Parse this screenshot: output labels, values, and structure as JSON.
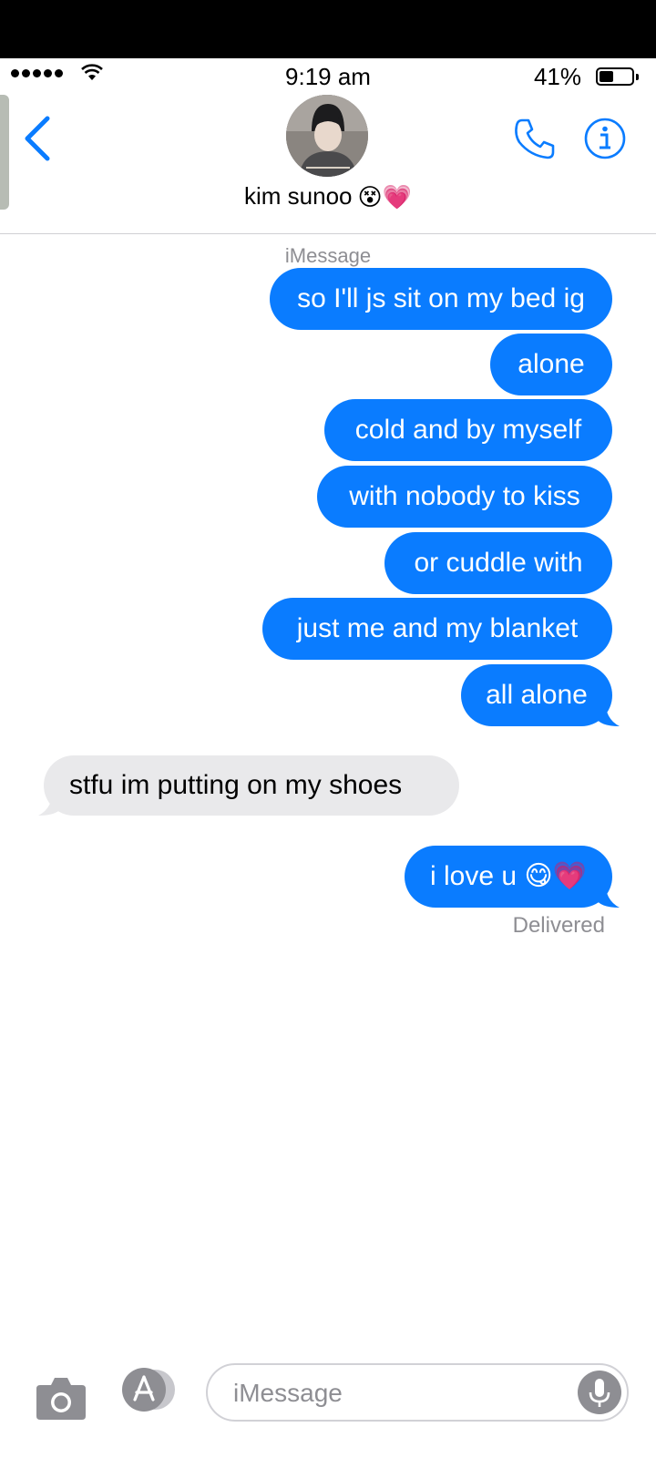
{
  "status_bar": {
    "time": "9:19 am",
    "battery_percent": "41%",
    "battery_level": 0.41,
    "signal_bars": 5
  },
  "header": {
    "contact_name": "kim sunoo",
    "name_emojis": "😵💗"
  },
  "thread": {
    "service_label": "iMessage",
    "messages": [
      {
        "direction": "outgoing",
        "text": "so I'll js sit on my bed ig"
      },
      {
        "direction": "outgoing",
        "text": "alone"
      },
      {
        "direction": "outgoing",
        "text": "cold and by myself"
      },
      {
        "direction": "outgoing",
        "text": "with nobody to kiss"
      },
      {
        "direction": "outgoing",
        "text": "or cuddle with"
      },
      {
        "direction": "outgoing",
        "text": "just me and my blanket"
      },
      {
        "direction": "outgoing",
        "text": "all alone"
      },
      {
        "direction": "incoming",
        "text": "stfu im putting on my shoes"
      },
      {
        "direction": "outgoing",
        "text": "i love u 😋💗"
      }
    ],
    "delivery_status": "Delivered"
  },
  "composer": {
    "placeholder": "iMessage",
    "value": ""
  },
  "colors": {
    "outgoing_bubble": "#0a7cff",
    "incoming_bubble": "#e9e9eb",
    "accent": "#0a7cff",
    "secondary_text": "#8e8e93"
  },
  "icons": [
    "signal-icon",
    "wifi-icon",
    "battery-icon",
    "back-chevron-icon",
    "phone-icon",
    "info-icon",
    "camera-icon",
    "app-store-icon",
    "microphone-icon"
  ]
}
